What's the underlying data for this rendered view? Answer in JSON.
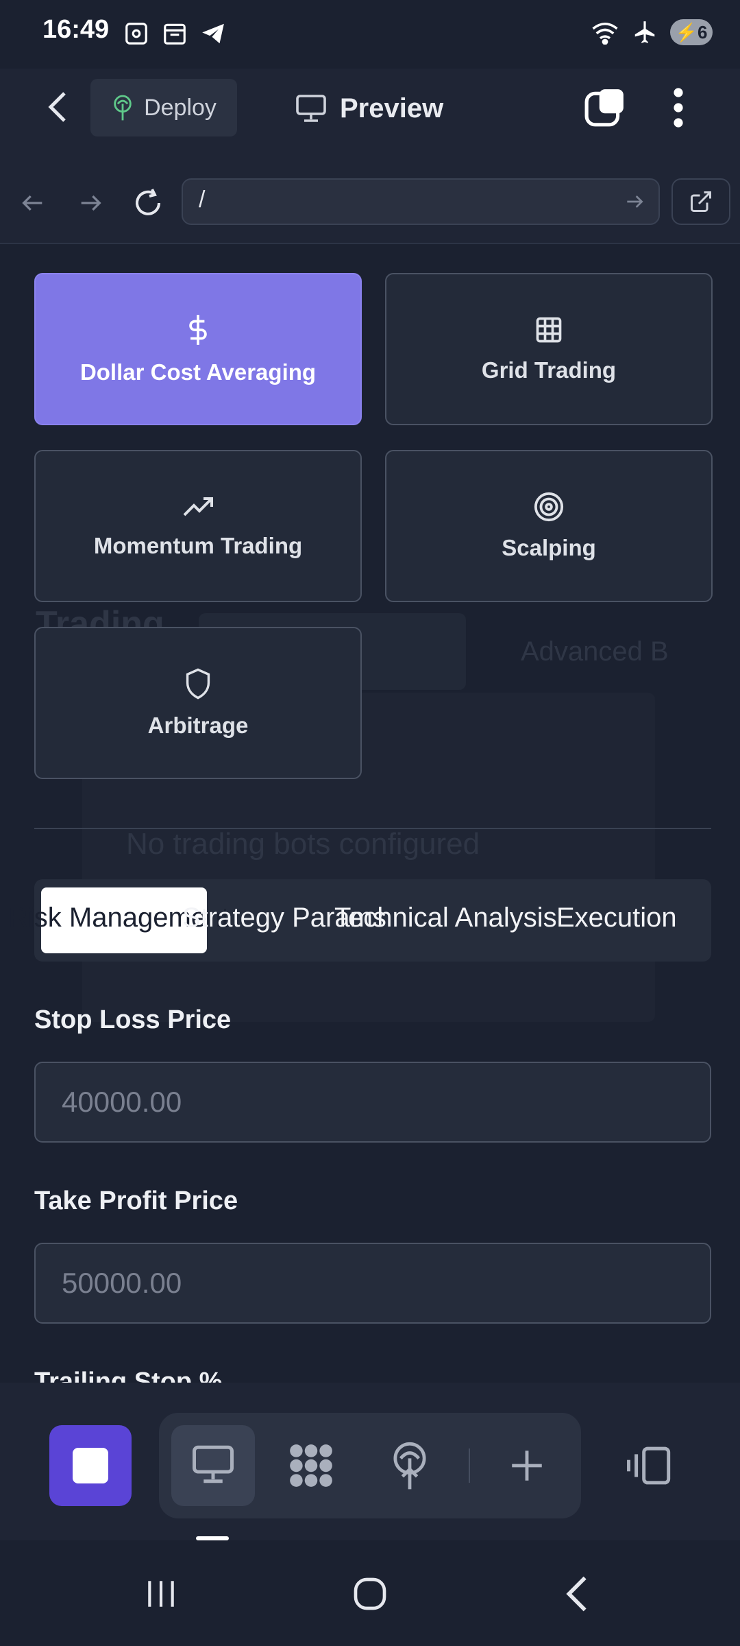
{
  "status_bar": {
    "time": "16:49",
    "battery": "6",
    "left_icons": [
      "screenshot-icon",
      "calendar-icon",
      "telegram-icon"
    ],
    "right_icons": [
      "wifi-icon",
      "airplane-icon",
      "battery-charging-icon"
    ]
  },
  "app_bar": {
    "deploy_label": "Deploy",
    "preview_label": "Preview"
  },
  "url_bar": {
    "url": "/"
  },
  "background": {
    "trading_heading": "Trading",
    "advanced_label": "Advanced B",
    "empty_message": "No trading bots configured"
  },
  "strategies": [
    {
      "label": "Dollar Cost Averaging",
      "icon": "dollar-icon",
      "active": true
    },
    {
      "label": "Grid Trading",
      "icon": "grid-icon",
      "active": false
    },
    {
      "label": "Momentum Trading",
      "icon": "trending-up-icon",
      "active": false
    },
    {
      "label": "Scalping",
      "icon": "target-icon",
      "active": false
    },
    {
      "label": "Arbitrage",
      "icon": "shield-icon",
      "active": false
    }
  ],
  "tabs": [
    {
      "label": "Risk Management",
      "active": true
    },
    {
      "label": "Strategy Params",
      "active": false
    },
    {
      "label": "Technical Analysis",
      "active": false
    },
    {
      "label": "Execution",
      "active": false
    }
  ],
  "form": {
    "stop_loss_label": "Stop Loss Price",
    "stop_loss_placeholder": "40000.00",
    "take_profit_label": "Take Profit Price",
    "take_profit_placeholder": "50000.00",
    "trailing_stop_label": "Trailing Stop %"
  },
  "colors": {
    "accent": "#7f77e6",
    "stop_button": "#5a44d6",
    "background": "#1b2130"
  }
}
